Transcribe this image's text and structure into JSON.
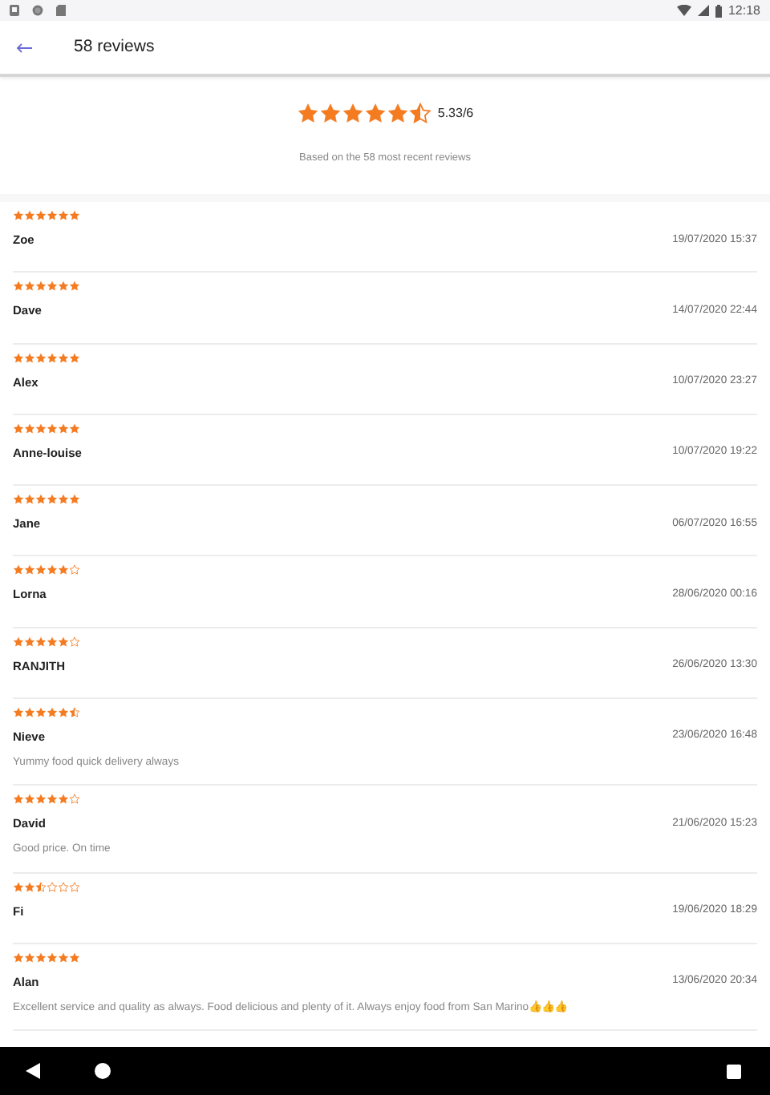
{
  "status_bar": {
    "time": "12:18"
  },
  "header": {
    "title": "58 reviews"
  },
  "summary": {
    "stars": 5.5,
    "score": "5.33/6",
    "note": "Based on the 58 most recent reviews"
  },
  "reviews": [
    {
      "stars": 6,
      "name": "Zoe",
      "date": "19/07/2020 15:37"
    },
    {
      "stars": 6,
      "name": "Dave",
      "date": "14/07/2020 22:44"
    },
    {
      "stars": 6,
      "name": "Alex",
      "date": "10/07/2020 23:27"
    },
    {
      "stars": 6,
      "name": "Anne-louise",
      "date": "10/07/2020 19:22"
    },
    {
      "stars": 6,
      "name": "Jane",
      "date": "06/07/2020 16:55"
    },
    {
      "stars": 5,
      "name": "Lorna",
      "date": "28/06/2020 00:16"
    },
    {
      "stars": 5,
      "name": "RANJITH",
      "date": "26/06/2020 13:30"
    },
    {
      "stars": 5.5,
      "name": "Nieve",
      "date": "23/06/2020 16:48",
      "comment": "Yummy food quick delivery always"
    },
    {
      "stars": 5,
      "name": "David",
      "date": "21/06/2020 15:23",
      "comment": "Good price. On time"
    },
    {
      "stars": 2.5,
      "name": "Fi",
      "date": "19/06/2020 18:29"
    },
    {
      "stars": 6,
      "name": "Alan",
      "date": "13/06/2020 20:34",
      "comment": "Excellent service and quality as always. Food delicious and plenty of it. Always enjoy food from San Marino👍👍👍"
    }
  ]
}
